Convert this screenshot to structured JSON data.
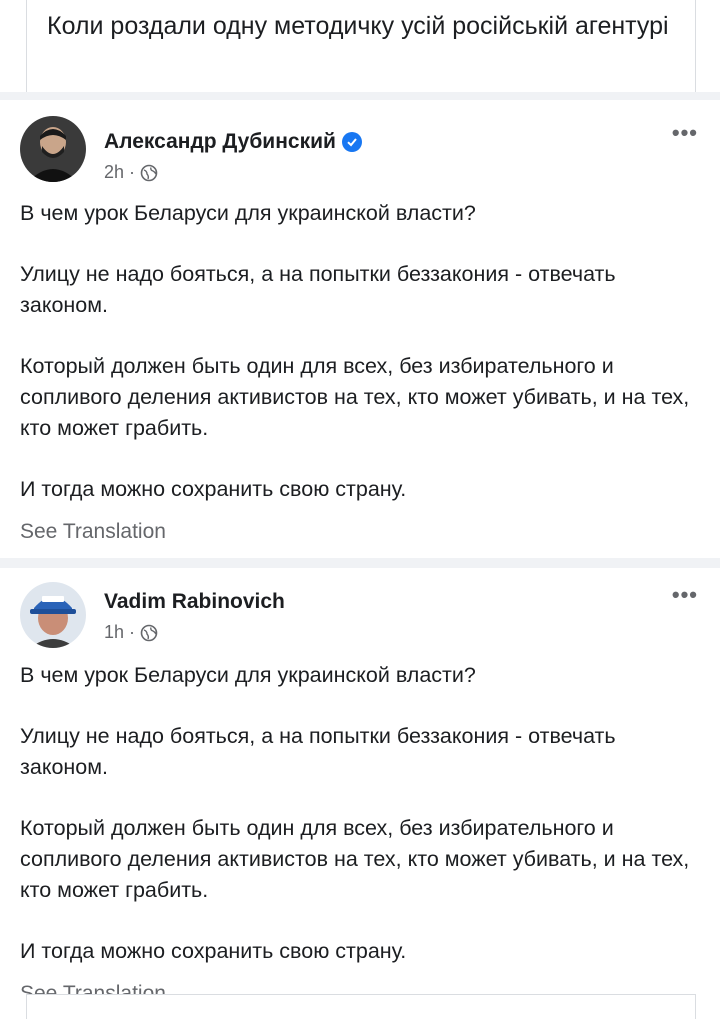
{
  "caption": "Коли роздали одну методичку усій російській агентурі",
  "posts": [
    {
      "author": "Александр Дубинский",
      "time": "2h",
      "dot": "·",
      "more": "•••",
      "paragraphs": [
        "В чем урок Беларуси для украинской власти?",
        "Улицу не надо бояться, а на попытки беззакония - отвечать законом.",
        "Который должен быть один для всех, без избирательного и сопливого деления активистов на тех, кто может убивать, и на тех, кто может грабить.",
        "И тогда можно сохранить свою страну."
      ],
      "see_translation": "See Translation",
      "verified_icon": "verified-badge-icon",
      "privacy_icon": "globe-icon"
    },
    {
      "author": "Vadim  Rabinovich",
      "time": "1h",
      "dot": "·",
      "more": "•••",
      "paragraphs": [
        "В чем урок Беларуси для украинской власти?",
        "Улицу не надо бояться, а на попытки беззакония - отвечать законом.",
        "Который должен быть один для всех, без избирательного и сопливого деления активистов на тех, кто может убивать, и на тех, кто может грабить.",
        "И тогда можно сохранить свою страну."
      ],
      "see_translation": "See Translation",
      "privacy_icon": "globe-icon"
    }
  ],
  "colors": {
    "accent": "#1877f2",
    "secondary_text": "#65676b",
    "divider": "#f0f2f5"
  }
}
